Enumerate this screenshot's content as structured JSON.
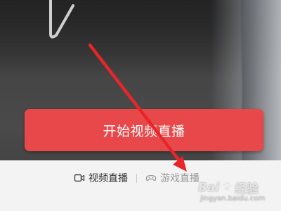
{
  "colors": {
    "accent": "#e9484a",
    "annotation_arrow": "#e8262a",
    "bottom_bar": "#f3f3f3"
  },
  "start_button": {
    "label": "开始视频直播"
  },
  "mode_tabs": [
    {
      "label": "视频直播",
      "icon": "video-camera-icon",
      "active": true
    },
    {
      "label": "游戏直播",
      "icon": "gamepad-icon",
      "active": false
    }
  ],
  "watermark": {
    "logo_text_1": "Bai",
    "logo_icon": "paw-icon",
    "logo_text_2": "经验",
    "url": "jingyan.baidu.com"
  }
}
